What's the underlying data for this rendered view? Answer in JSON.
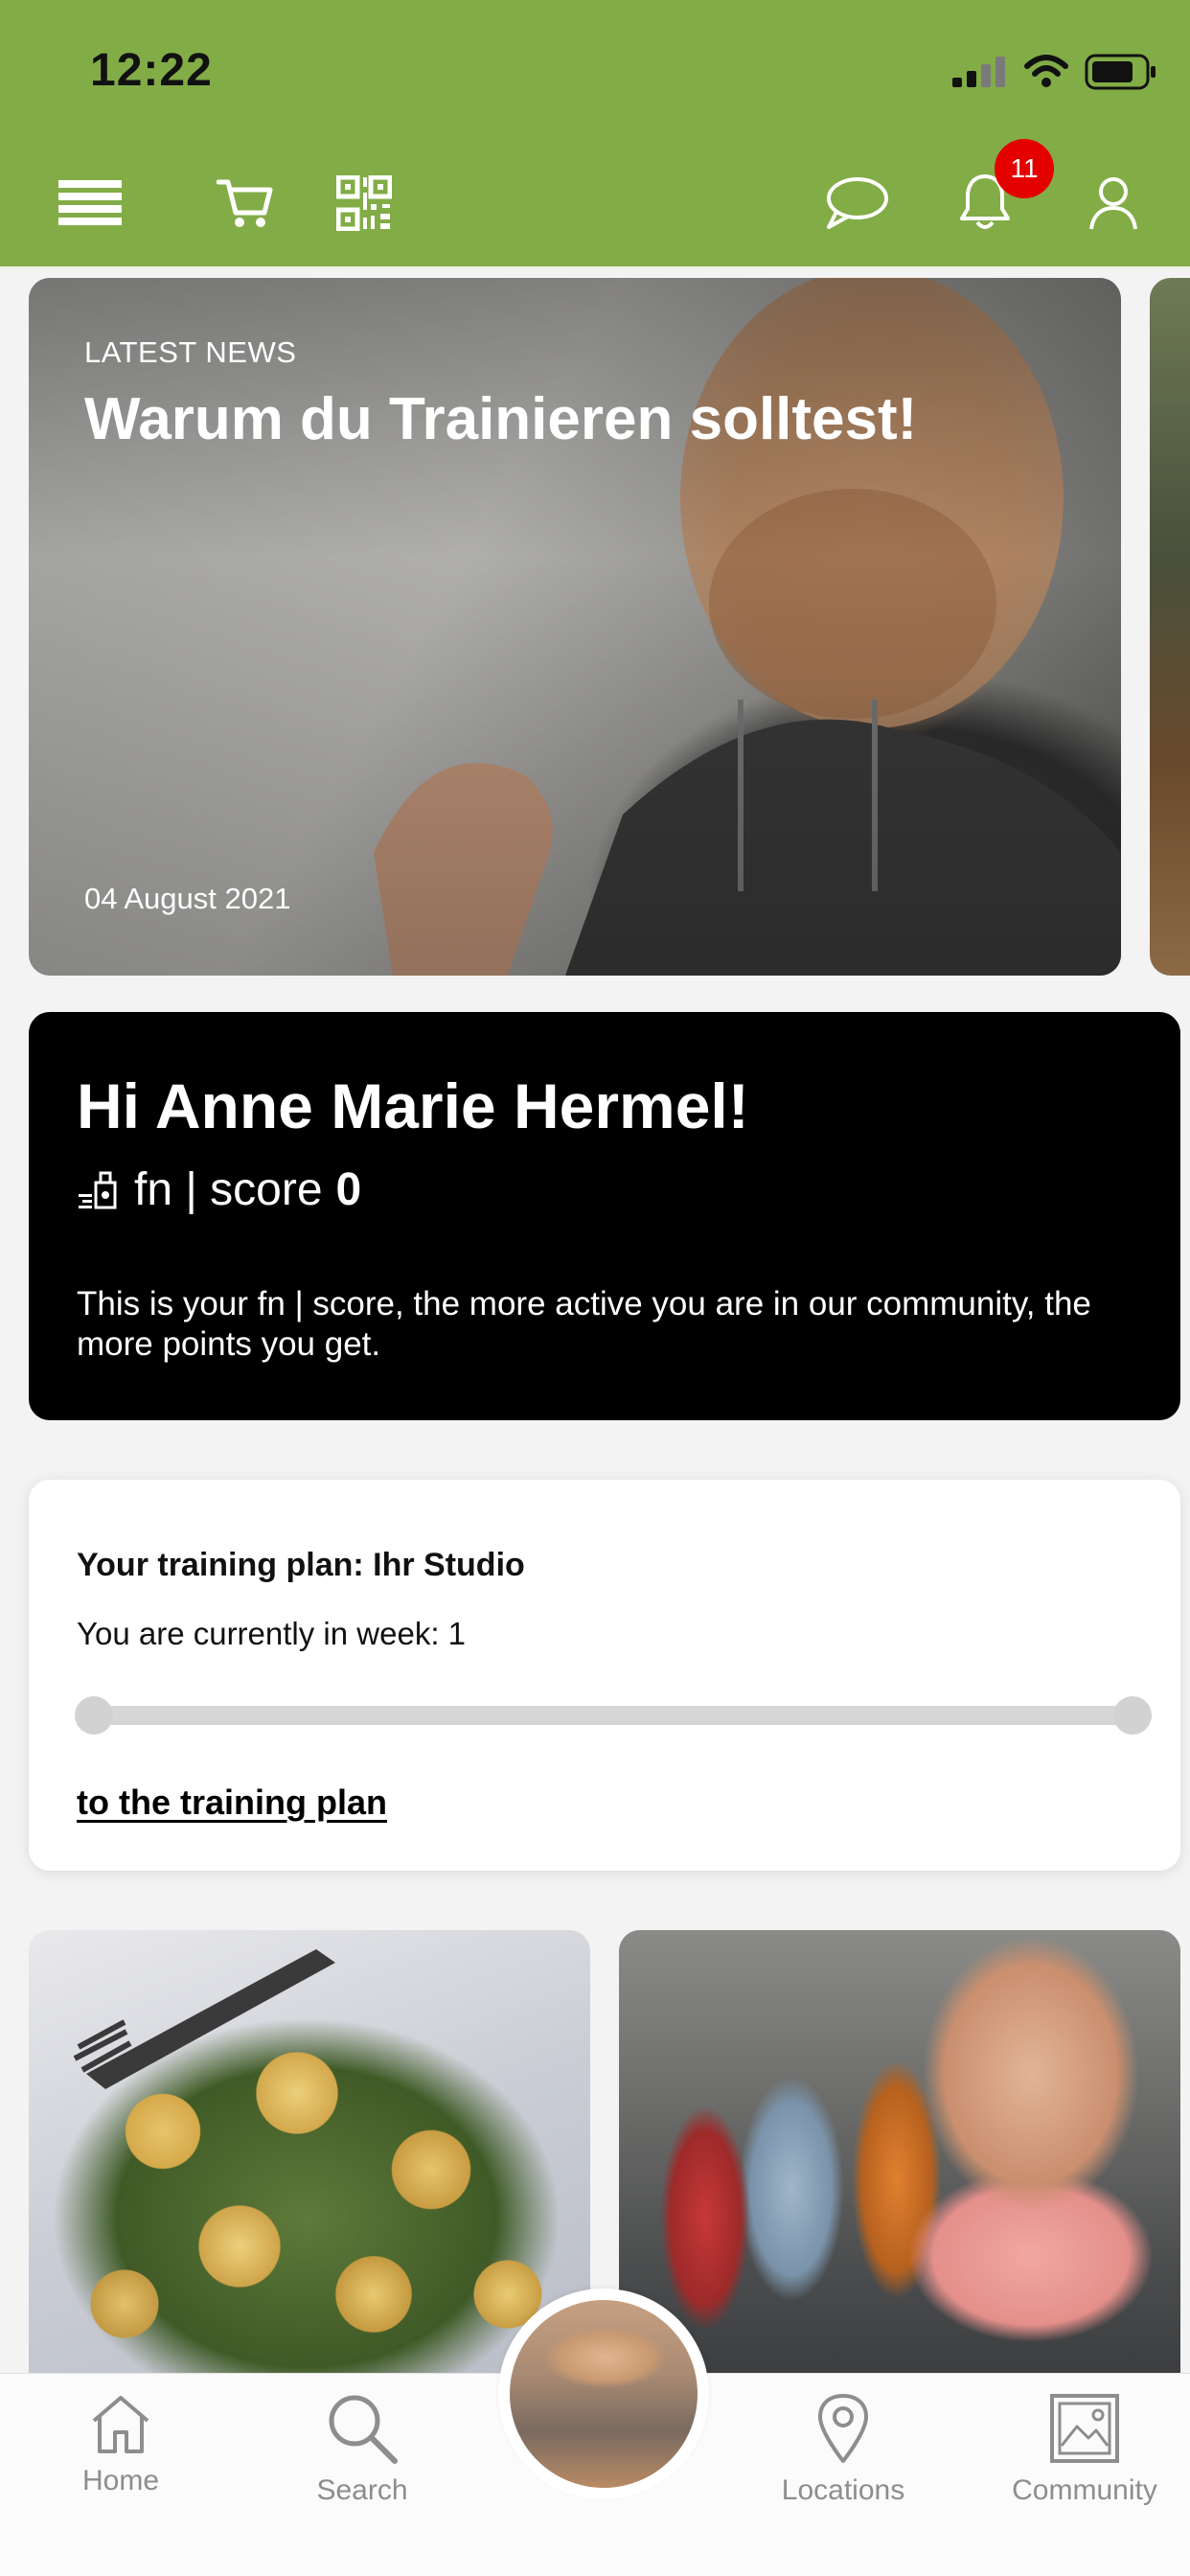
{
  "status_bar": {
    "time": "12:22"
  },
  "header": {
    "notification_count": "11",
    "icons": [
      "menu-icon",
      "cart-icon",
      "qr-code-icon",
      "chat-icon",
      "bell-icon",
      "profile-icon"
    ],
    "brand_color": "#82ac46"
  },
  "news": {
    "label": "LATEST NEWS",
    "title": "Warum du Trainieren solltest!",
    "date": "04 August 2021"
  },
  "score_card": {
    "greeting": "Hi Anne Marie Hermel!",
    "score_label": "fn | score",
    "score_value": "0",
    "description": "This is your fn | score, the more active you are in our community, the more points you get."
  },
  "training_plan": {
    "title": "Your training plan: Ihr Studio",
    "week_text": "You are currently in week: 1",
    "link": "to the training plan"
  },
  "tabbar": {
    "home": "Home",
    "search": "Search",
    "locations": "Locations",
    "community": "Community"
  }
}
